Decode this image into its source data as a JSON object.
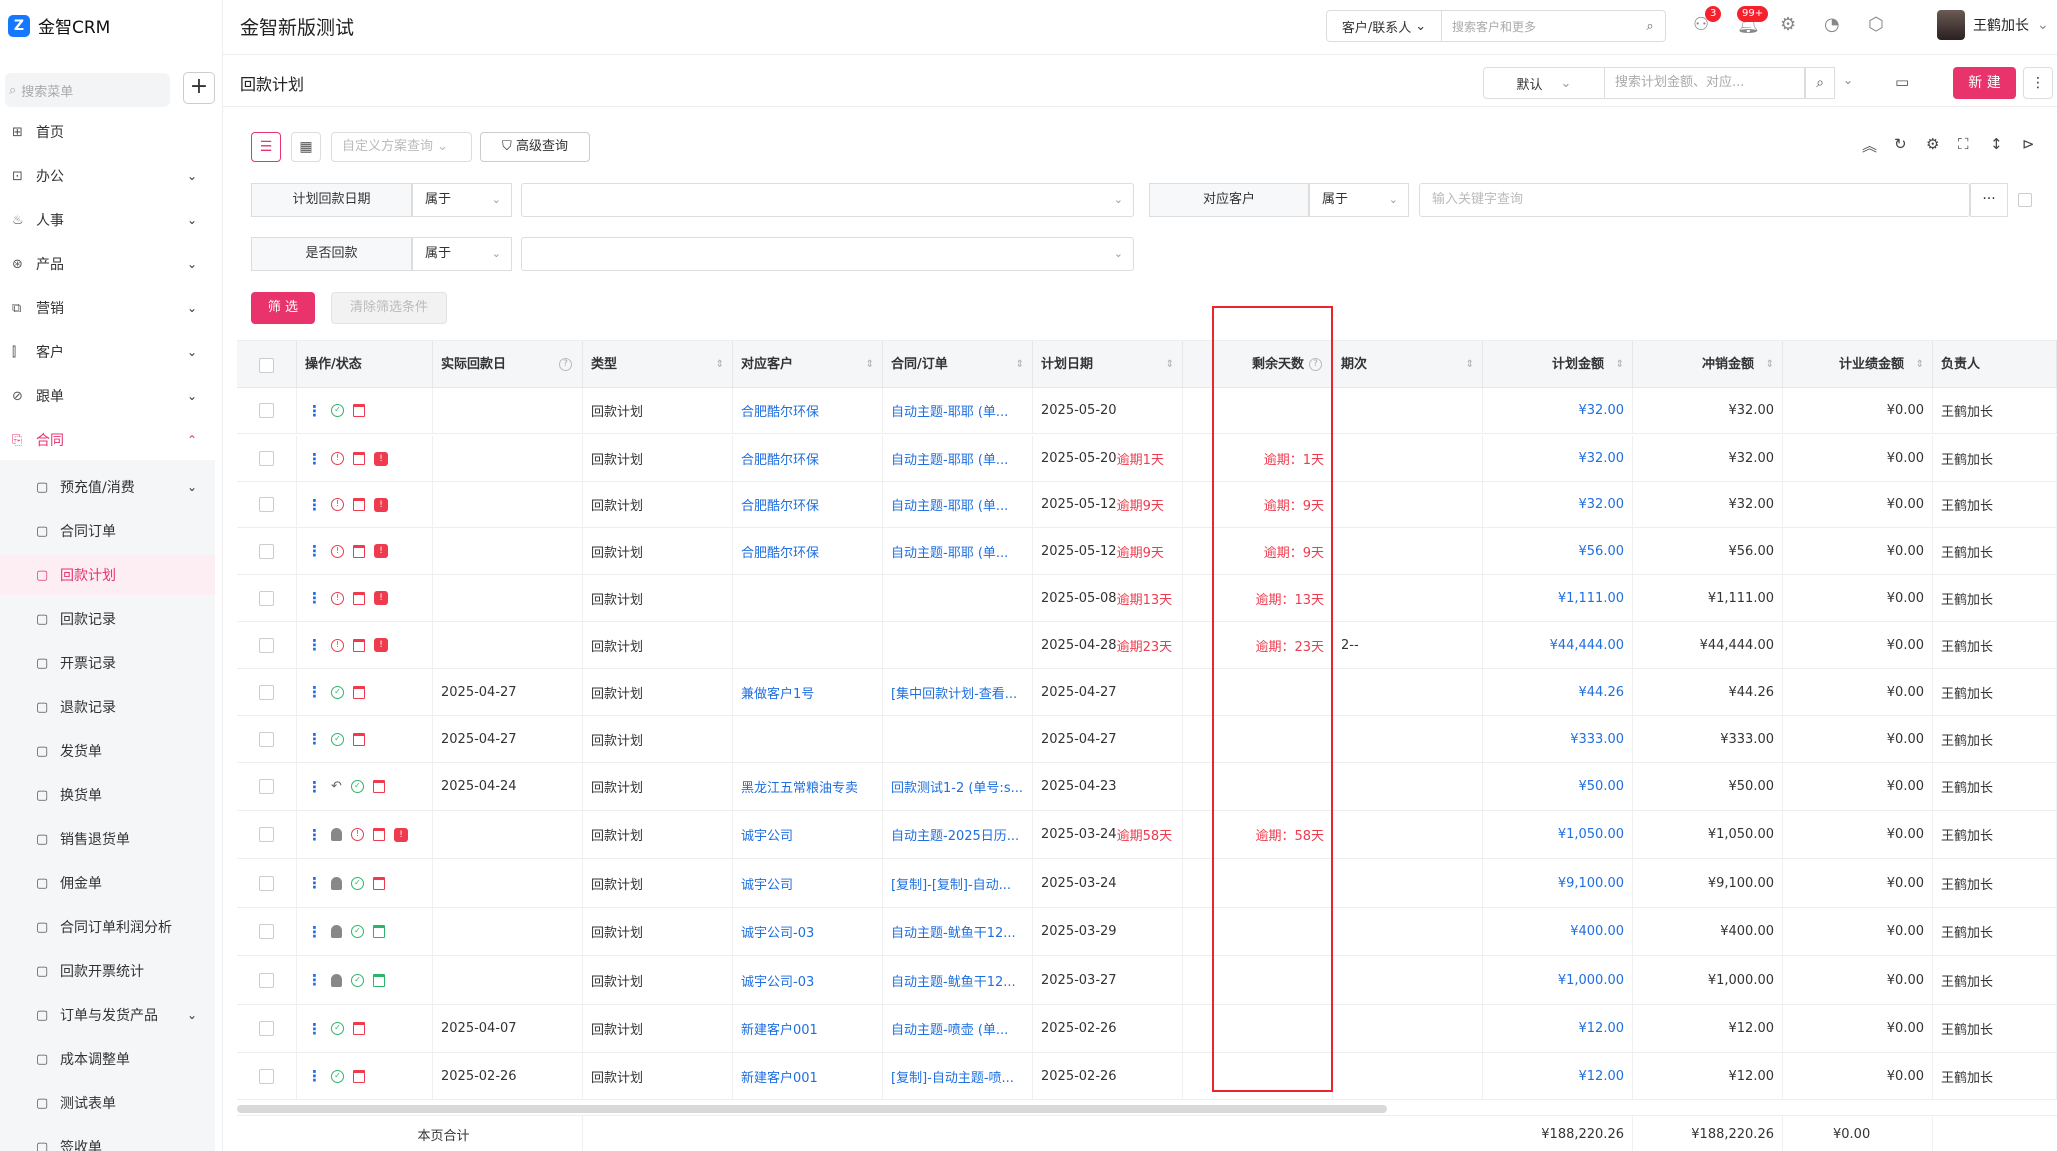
{
  "brand": {
    "logo_text": "金智CRM",
    "logo_glyph": "Z"
  },
  "header": {
    "app_title": "金智新版测试",
    "search_type": "客户/联系人",
    "search_placeholder": "搜索客户和更多",
    "badge_1": "3",
    "badge_2": "99+",
    "user_name": "王鹤加长"
  },
  "sidebar": {
    "search_placeholder": "搜索菜单",
    "add": "+",
    "items": [
      {
        "label": "首页",
        "icon": "home-icon"
      },
      {
        "label": "办公",
        "icon": "briefcase-icon"
      },
      {
        "label": "人事",
        "icon": "people-icon"
      },
      {
        "label": "产品",
        "icon": "product-icon"
      },
      {
        "label": "营销",
        "icon": "marketing-icon"
      },
      {
        "label": "客户",
        "icon": "customer-icon"
      },
      {
        "label": "跟单",
        "icon": "follow-icon"
      },
      {
        "label": "合同",
        "icon": "contract-icon"
      }
    ],
    "sub_items": [
      "预充值/消费",
      "合同订单",
      "回款计划",
      "回款记录",
      "开票记录",
      "退款记录",
      "发货单",
      "换货单",
      "销售退货单",
      "佣金单",
      "合同订单利润分析",
      "回款开票统计",
      "订单与发货产品",
      "成本调整单",
      "测试表单",
      "签收单"
    ]
  },
  "page": {
    "title": "回款计划",
    "view": "默认",
    "search_placeholder": "搜索计划金额、对应...",
    "new_label": "新 建",
    "more": "⋮"
  },
  "toolbar": {
    "scheme_placeholder": "自定义方案查询",
    "advanced": "高级查询"
  },
  "filters": {
    "f1_label": "计划回款日期",
    "f1_op": "属于",
    "f2_label": "对应客户",
    "f2_op": "属于",
    "f2_placeholder": "输入关键字查询",
    "f3_label": "是否回款",
    "f3_op": "属于",
    "more": "···",
    "filter_btn": "筛 选",
    "clear_btn": "清除筛选条件"
  },
  "table": {
    "columns": {
      "ops": "操作/状态",
      "actual": "实际回款日",
      "type": "类型",
      "customer": "对应客户",
      "order": "合同/订单",
      "plan_date": "计划日期",
      "remain": "剩余天数",
      "period": "期次",
      "plan_amt": "计划金额",
      "offset_amt": "冲销金额",
      "perf_amt": "计业绩金额",
      "owner": "负责人"
    },
    "rows": [
      {
        "actual": "",
        "type": "回款计划",
        "customer": "合肥酷尔环保",
        "order": "自动主题-耶耶 (单...",
        "plan_date": "2025-05-20",
        "overdue": "",
        "remain": "",
        "period": "",
        "plan_amt": "¥32.00",
        "offset_amt": "¥32.00",
        "perf_amt": "¥0.00",
        "owner": "王鹤加长"
      },
      {
        "actual": "",
        "type": "回款计划",
        "customer": "合肥酷尔环保",
        "order": "自动主题-耶耶 (单...",
        "plan_date": "2025-05-20",
        "overdue": "逾期1天",
        "remain": "逾期：1天",
        "period": "",
        "plan_amt": "¥32.00",
        "offset_amt": "¥32.00",
        "perf_amt": "¥0.00",
        "owner": "王鹤加长"
      },
      {
        "actual": "",
        "type": "回款计划",
        "customer": "合肥酷尔环保",
        "order": "自动主题-耶耶 (单...",
        "plan_date": "2025-05-12",
        "overdue": "逾期9天",
        "remain": "逾期：9天",
        "period": "",
        "plan_amt": "¥32.00",
        "offset_amt": "¥32.00",
        "perf_amt": "¥0.00",
        "owner": "王鹤加长"
      },
      {
        "actual": "",
        "type": "回款计划",
        "customer": "合肥酷尔环保",
        "order": "自动主题-耶耶 (单...",
        "plan_date": "2025-05-12",
        "overdue": "逾期9天",
        "remain": "逾期：9天",
        "period": "",
        "plan_amt": "¥56.00",
        "offset_amt": "¥56.00",
        "perf_amt": "¥0.00",
        "owner": "王鹤加长"
      },
      {
        "actual": "",
        "type": "回款计划",
        "customer": "",
        "order": "",
        "plan_date": "2025-05-08",
        "overdue": "逾期13天",
        "remain": "逾期：13天",
        "period": "",
        "plan_amt": "¥1,111.00",
        "offset_amt": "¥1,111.00",
        "perf_amt": "¥0.00",
        "owner": "王鹤加长"
      },
      {
        "actual": "",
        "type": "回款计划",
        "customer": "",
        "order": "",
        "plan_date": "2025-04-28",
        "overdue": "逾期23天",
        "remain": "逾期：23天",
        "period": "2--",
        "plan_amt": "¥44,444.00",
        "offset_amt": "¥44,444.00",
        "perf_amt": "¥0.00",
        "owner": "王鹤加长"
      },
      {
        "actual": "2025-04-27",
        "type": "回款计划",
        "customer": "兼做客户1号",
        "order": "[集中回款计划-查看...",
        "plan_date": "2025-04-27",
        "overdue": "",
        "remain": "",
        "period": "",
        "plan_amt": "¥44.26",
        "offset_amt": "¥44.26",
        "perf_amt": "¥0.00",
        "owner": "王鹤加长"
      },
      {
        "actual": "2025-04-27",
        "type": "回款计划",
        "customer": "",
        "order": "",
        "plan_date": "2025-04-27",
        "overdue": "",
        "remain": "",
        "period": "",
        "plan_amt": "¥333.00",
        "offset_amt": "¥333.00",
        "perf_amt": "¥0.00",
        "owner": "王鹤加长"
      },
      {
        "actual": "2025-04-24",
        "type": "回款计划",
        "customer": "黑龙江五常粮油专卖",
        "order": "回款测试1-2 (单号:s...",
        "plan_date": "2025-04-23",
        "overdue": "",
        "remain": "",
        "period": "",
        "plan_amt": "¥50.00",
        "offset_amt": "¥50.00",
        "perf_amt": "¥0.00",
        "owner": "王鹤加长"
      },
      {
        "actual": "",
        "type": "回款计划",
        "customer": "诚宇公司",
        "order": "自动主题-2025日历...",
        "plan_date": "2025-03-24",
        "overdue": "逾期58天",
        "remain": "逾期：58天",
        "period": "",
        "plan_amt": "¥1,050.00",
        "offset_amt": "¥1,050.00",
        "perf_amt": "¥0.00",
        "owner": "王鹤加长"
      },
      {
        "actual": "",
        "type": "回款计划",
        "customer": "诚宇公司",
        "order": "[复制]-[复制]-自动...",
        "plan_date": "2025-03-24",
        "overdue": "",
        "remain": "",
        "period": "",
        "plan_amt": "¥9,100.00",
        "offset_amt": "¥9,100.00",
        "perf_amt": "¥0.00",
        "owner": "王鹤加长"
      },
      {
        "actual": "",
        "type": "回款计划",
        "customer": "诚宇公司-03",
        "order": "自动主题-鱿鱼干12...",
        "plan_date": "2025-03-29",
        "overdue": "",
        "remain": "",
        "period": "",
        "plan_amt": "¥400.00",
        "offset_amt": "¥400.00",
        "perf_amt": "¥0.00",
        "owner": "王鹤加长"
      },
      {
        "actual": "",
        "type": "回款计划",
        "customer": "诚宇公司-03",
        "order": "自动主题-鱿鱼干12...",
        "plan_date": "2025-03-27",
        "overdue": "",
        "remain": "",
        "period": "",
        "plan_amt": "¥1,000.00",
        "offset_amt": "¥1,000.00",
        "perf_amt": "¥0.00",
        "owner": "王鹤加长"
      },
      {
        "actual": "2025-04-07",
        "type": "回款计划",
        "customer": "新建客户001",
        "order": "自动主题-喷壶 (单...",
        "plan_date": "2025-02-26",
        "overdue": "",
        "remain": "",
        "period": "",
        "plan_amt": "¥12.00",
        "offset_amt": "¥12.00",
        "perf_amt": "¥0.00",
        "owner": "王鹤加长"
      },
      {
        "actual": "2025-02-26",
        "type": "回款计划",
        "customer": "新建客户001",
        "order": "[复制]-自动主题-喷...",
        "plan_date": "2025-02-26",
        "overdue": "",
        "remain": "",
        "period": "",
        "plan_amt": "¥12.00",
        "offset_amt": "¥12.00",
        "perf_amt": "¥0.00",
        "owner": "王鹤加长"
      }
    ],
    "ops_icons": [
      [
        "green",
        "trash"
      ],
      [
        "red",
        "trash",
        "warn"
      ],
      [
        "red",
        "trash",
        "warn"
      ],
      [
        "red",
        "trash",
        "warn"
      ],
      [
        "red",
        "trash",
        "warn"
      ],
      [
        "red",
        "trash",
        "warn"
      ],
      [
        "green",
        "trash"
      ],
      [
        "green",
        "trash"
      ],
      [
        "undo",
        "green",
        "trash"
      ],
      [
        "user",
        "red",
        "trash",
        "warn"
      ],
      [
        "user",
        "green",
        "trash"
      ],
      [
        "user",
        "green",
        "trash-green"
      ],
      [
        "user",
        "green",
        "trash-green"
      ],
      [
        "green",
        "trash"
      ],
      [
        "green",
        "trash"
      ]
    ],
    "total": {
      "label": "本页合计",
      "plan_amt": "¥188,220.26",
      "offset_amt": "¥188,220.26",
      "perf_amt": "¥0.00"
    }
  },
  "colors": {
    "accent": "#e8336d",
    "link": "#1f6fe0",
    "overdue": "#ee3b4d",
    "highlight_box": "#e8262c"
  }
}
